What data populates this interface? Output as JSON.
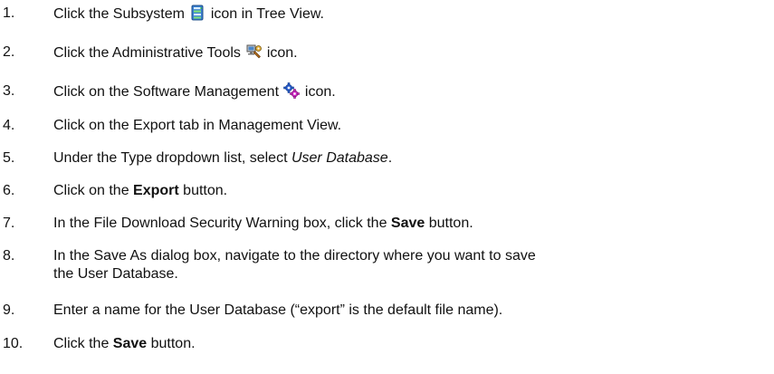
{
  "steps": [
    {
      "num": "1.",
      "before": "Click the Subsystem",
      "icon": "subsystem-icon",
      "after": " icon in Tree View."
    },
    {
      "num": "2.",
      "before": "Click the Administrative Tools",
      "icon": "administrative-tools-icon",
      "after": " icon."
    },
    {
      "num": "3.",
      "before": "Click on the Software Management",
      "icon": "software-management-icon",
      "after": " icon."
    },
    {
      "num": "4.",
      "text": "Click on the Export tab in Management View."
    },
    {
      "num": "5.",
      "before": "Under the Type dropdown list, select ",
      "italic": "User Database",
      "after": "."
    },
    {
      "num": "6.",
      "before": "Click on the ",
      "bold": "Export",
      "after": " button."
    },
    {
      "num": "7.",
      "before": "In the File Download Security Warning box, click the ",
      "bold": "Save",
      "after": " button."
    },
    {
      "num": "8.",
      "line1": "In the Save As dialog box, navigate to the directory where you want to save",
      "line2": "the User Database."
    },
    {
      "num": "9.",
      "text": "Enter a name for the User Database (“export” is the default file name)."
    },
    {
      "num": "10.",
      "before": "Click the ",
      "bold": "Save",
      "after": " button."
    }
  ]
}
